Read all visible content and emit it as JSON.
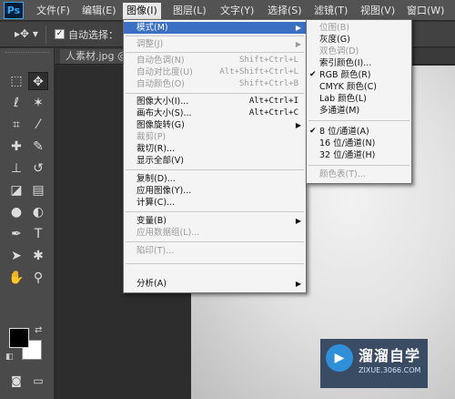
{
  "app": {
    "logo": "Ps"
  },
  "menubar": {
    "items": [
      {
        "label": "文件(F)"
      },
      {
        "label": "编辑(E)"
      },
      {
        "label": "图像(I)"
      },
      {
        "label": "图层(L)"
      },
      {
        "label": "文字(Y)"
      },
      {
        "label": "选择(S)"
      },
      {
        "label": "滤镜(T)"
      },
      {
        "label": "视图(V)"
      },
      {
        "label": "窗口(W)"
      }
    ],
    "active_index": 2
  },
  "options_bar": {
    "tool_glyph": "▸✥ ▾",
    "auto_select_label": "自动选择：",
    "auto_select_checked": true
  },
  "document_tab": {
    "title": "人素材.jpg @"
  },
  "image_menu": {
    "items": [
      {
        "label": "模式(M)",
        "shortcut": "",
        "submenu": true,
        "disabled": false,
        "highlighted": true
      },
      {
        "label": "调整(J)",
        "shortcut": "",
        "submenu": true,
        "disabled": true,
        "highlighted": false
      },
      {
        "label": "自动色调(N)",
        "shortcut": "Shift+Ctrl+L",
        "submenu": false,
        "disabled": true,
        "highlighted": false
      },
      {
        "label": "自动对比度(U)",
        "shortcut": "Alt+Shift+Ctrl+L",
        "submenu": false,
        "disabled": true,
        "highlighted": false
      },
      {
        "label": "自动颜色(O)",
        "shortcut": "Shift+Ctrl+B",
        "submenu": false,
        "disabled": true,
        "highlighted": false
      },
      {
        "label": "图像大小(I)...",
        "shortcut": "Alt+Ctrl+I",
        "submenu": false,
        "disabled": false,
        "highlighted": false
      },
      {
        "label": "画布大小(S)...",
        "shortcut": "Alt+Ctrl+C",
        "submenu": false,
        "disabled": false,
        "highlighted": false
      },
      {
        "label": "图像旋转(G)",
        "shortcut": "",
        "submenu": true,
        "disabled": false,
        "highlighted": false
      },
      {
        "label": "裁剪(P)",
        "shortcut": "",
        "submenu": false,
        "disabled": true,
        "highlighted": false
      },
      {
        "label": "裁切(R)...",
        "shortcut": "",
        "submenu": false,
        "disabled": false,
        "highlighted": false
      },
      {
        "label": "显示全部(V)",
        "shortcut": "",
        "submenu": false,
        "disabled": false,
        "highlighted": false
      },
      {
        "label": "复制(D)...",
        "shortcut": "",
        "submenu": false,
        "disabled": false,
        "highlighted": false
      },
      {
        "label": "应用图像(Y)...",
        "shortcut": "",
        "submenu": false,
        "disabled": false,
        "highlighted": false
      },
      {
        "label": "计算(C)...",
        "shortcut": "",
        "submenu": false,
        "disabled": false,
        "highlighted": false
      },
      {
        "label": "变量(B)",
        "shortcut": "",
        "submenu": true,
        "disabled": false,
        "highlighted": false
      },
      {
        "label": "应用数据组(L)...",
        "shortcut": "",
        "submenu": false,
        "disabled": true,
        "highlighted": false
      },
      {
        "label": "陷印(T)...",
        "shortcut": "",
        "submenu": false,
        "disabled": true,
        "highlighted": false
      },
      {
        "label": "分析(A)",
        "shortcut": "",
        "submenu": true,
        "disabled": false,
        "highlighted": false
      }
    ]
  },
  "mode_submenu": {
    "items": [
      {
        "label": "位图(B)",
        "disabled": true,
        "checked": false
      },
      {
        "label": "灰度(G)",
        "disabled": false,
        "checked": false
      },
      {
        "label": "双色调(D)",
        "disabled": true,
        "checked": false
      },
      {
        "label": "索引颜色(I)...",
        "disabled": false,
        "checked": false
      },
      {
        "label": "RGB 颜色(R)",
        "disabled": false,
        "checked": true
      },
      {
        "label": "CMYK 颜色(C)",
        "disabled": false,
        "checked": false
      },
      {
        "label": "Lab 颜色(L)",
        "disabled": false,
        "checked": false
      },
      {
        "label": "多通道(M)",
        "disabled": false,
        "checked": false
      },
      {
        "label": "8 位/通道(A)",
        "disabled": false,
        "checked": true
      },
      {
        "label": "16 位/通道(N)",
        "disabled": false,
        "checked": false
      },
      {
        "label": "32 位/通道(H)",
        "disabled": false,
        "checked": false
      },
      {
        "label": "颜色表(T)...",
        "disabled": true,
        "checked": false
      }
    ]
  },
  "watermark": {
    "title": "溜溜自学",
    "subtitle": "ZIXUE.3066.COM"
  },
  "colors": {
    "accent": "#3a6fc4",
    "foreground": "#000000",
    "background": "#ffffff"
  }
}
